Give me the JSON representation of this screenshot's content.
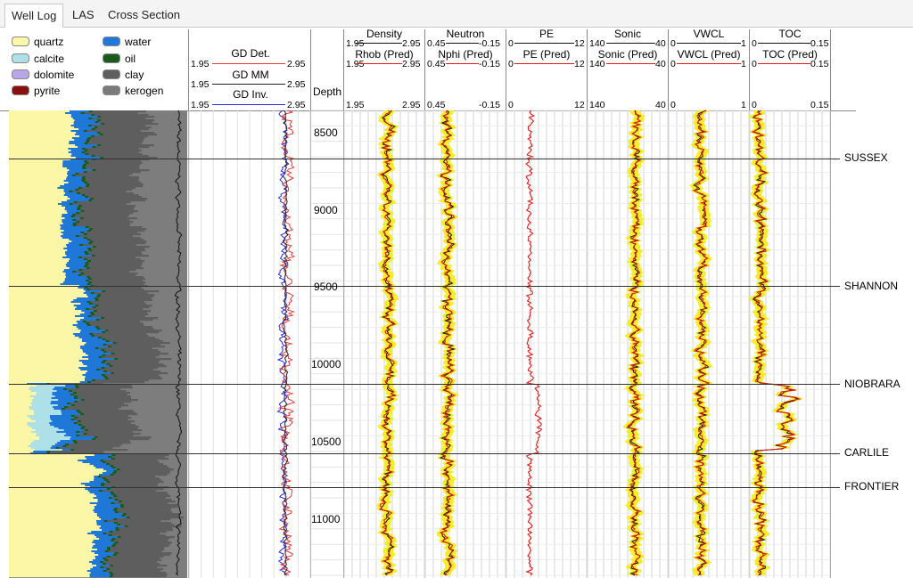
{
  "tabs": [
    {
      "label": "Well Log",
      "active": true
    },
    {
      "label": "LAS",
      "active": false
    },
    {
      "label": "Cross Section",
      "active": false
    }
  ],
  "legend": [
    {
      "label": "quartz",
      "color": "#fbf7a6"
    },
    {
      "label": "water",
      "color": "#1f78d8"
    },
    {
      "label": "calcite",
      "color": "#aee0e8"
    },
    {
      "label": "oil",
      "color": "#1a5a1a"
    },
    {
      "label": "dolomite",
      "color": "#b9a6e8"
    },
    {
      "label": "clay",
      "color": "#5e5e5e"
    },
    {
      "label": "pyrite",
      "color": "#8b0e0e"
    },
    {
      "label": "kerogen",
      "color": "#7a7a7a"
    }
  ],
  "gd": {
    "curves": [
      {
        "label": "GD Det.",
        "color": "#e03a3a"
      },
      {
        "label": "GD MM",
        "color": "#222222"
      },
      {
        "label": "GD Inv.",
        "color": "#2a2aee"
      }
    ],
    "min": "1.95",
    "max": "2.95"
  },
  "depth": {
    "header": "Depth",
    "ticks": [
      "8500",
      "9000",
      "9500",
      "10000",
      "10500",
      "11000"
    ]
  },
  "tracks": [
    {
      "title": "Density",
      "sub": "Rhob (Pred)",
      "min": "1.95",
      "max": "2.95"
    },
    {
      "title": "Neutron",
      "sub": "Nphi (Pred)",
      "min": "0.45",
      "max": "-0.15"
    },
    {
      "title": "PE",
      "sub": "PE (Pred)",
      "min": "0",
      "max": "12"
    },
    {
      "title": "Sonic",
      "sub": "Sonic (Pred)",
      "min": "140",
      "max": "40"
    },
    {
      "title": "VWCL",
      "sub": "VWCL (Pred)",
      "min": "0",
      "max": "1"
    },
    {
      "title": "TOC",
      "sub": "TOC (Pred)",
      "min": "0",
      "max": "0.15"
    }
  ],
  "formations": [
    "SUSSEX",
    "SHANNON",
    "NIOBRARA",
    "CARLILE",
    "FRONTIER"
  ],
  "colors": {
    "measured": "#111111",
    "predicted": "#e01a1a",
    "band": "#f5ec14",
    "grid": "#d4d4d4",
    "top_line": "#333333"
  }
}
